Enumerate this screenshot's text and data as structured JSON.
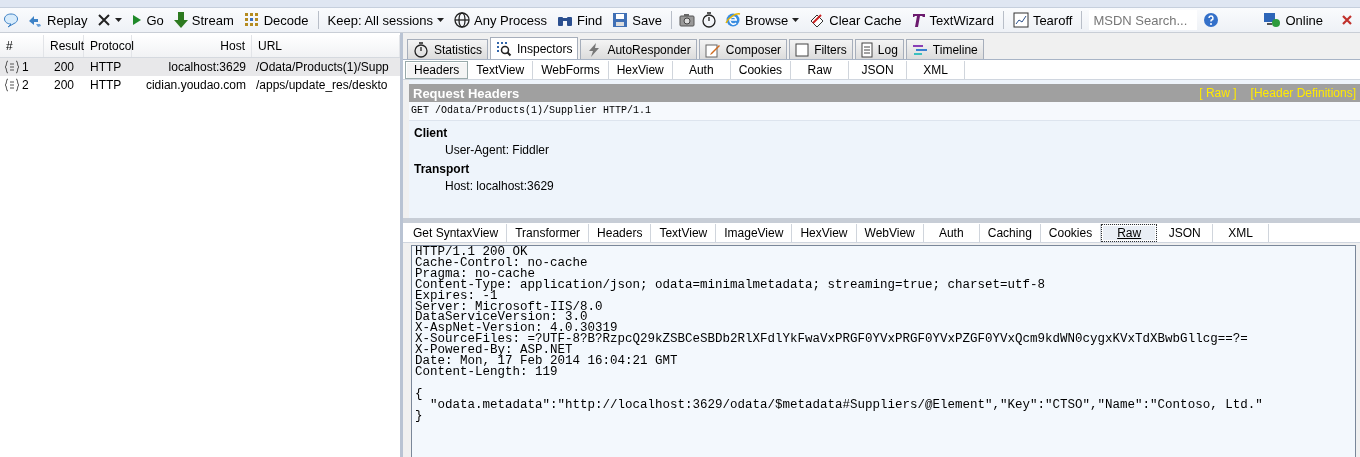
{
  "toolbar": {
    "items": [
      {
        "kind": "icon"
      },
      {
        "kind": "button",
        "label": "Replay"
      },
      {
        "kind": "dropdown"
      },
      {
        "kind": "button",
        "label": "Go"
      },
      {
        "kind": "button",
        "label": "Stream"
      },
      {
        "kind": "button",
        "label": "Decode"
      },
      {
        "kind": "separator"
      },
      {
        "kind": "dropdown",
        "label": "Keep: All sessions"
      },
      {
        "kind": "button",
        "label": "Any Process"
      },
      {
        "kind": "button",
        "label": "Find"
      },
      {
        "kind": "button",
        "label": "Save"
      },
      {
        "kind": "separator"
      },
      {
        "kind": "icon"
      },
      {
        "kind": "icon"
      },
      {
        "kind": "dropdown",
        "label": "Browse"
      },
      {
        "kind": "button",
        "label": "Clear Cache"
      },
      {
        "kind": "button",
        "label": "TextWizard"
      },
      {
        "kind": "separator"
      },
      {
        "kind": "button",
        "label": "Tearoff"
      },
      {
        "kind": "separator"
      },
      {
        "kind": "search",
        "placeholder": "MSDN Search..."
      },
      {
        "kind": "icon"
      }
    ],
    "status": "Online"
  },
  "sessions": {
    "columns": [
      "#",
      "Result",
      "Protocol",
      "Host",
      "URL"
    ],
    "rows": [
      {
        "id": "1",
        "result": "200",
        "protocol": "HTTP",
        "host": "localhost:3629",
        "url": "/Odata/Products(1)/Supp",
        "selected": true
      },
      {
        "id": "2",
        "result": "200",
        "protocol": "HTTP",
        "host": "cidian.youdao.com",
        "url": "/apps/update_res/deskto",
        "selected": false
      }
    ]
  },
  "tabs": [
    {
      "label": "Statistics",
      "selected": false
    },
    {
      "label": "Inspectors",
      "selected": true
    },
    {
      "label": "AutoResponder",
      "selected": false
    },
    {
      "label": "Composer",
      "selected": false
    },
    {
      "label": "Filters",
      "selected": false
    },
    {
      "label": "Log",
      "selected": false
    },
    {
      "label": "Timeline",
      "selected": false
    }
  ],
  "request_tabs": [
    {
      "label": "Headers",
      "selected": true
    },
    {
      "label": "TextView",
      "selected": false
    },
    {
      "label": "WebForms",
      "selected": false
    },
    {
      "label": "HexView",
      "selected": false
    },
    {
      "label": "Auth",
      "selected": false
    },
    {
      "label": "Cookies",
      "selected": false
    },
    {
      "label": "Raw",
      "selected": false
    },
    {
      "label": "JSON",
      "selected": false
    },
    {
      "label": "XML",
      "selected": false
    }
  ],
  "request_headers": {
    "title": "Request Headers",
    "links": [
      "[ Raw ]",
      "[Header Definitions]"
    ],
    "request_line": "GET /Odata/Products(1)/Supplier HTTP/1.1",
    "groups": [
      {
        "name": "Client",
        "headers": [
          "User-Agent: Fiddler"
        ]
      },
      {
        "name": "Transport",
        "headers": [
          "Host: localhost:3629"
        ]
      }
    ]
  },
  "response_tabs": [
    {
      "label": "Get SyntaxView",
      "selected": false
    },
    {
      "label": "Transformer",
      "selected": false
    },
    {
      "label": "Headers",
      "selected": false
    },
    {
      "label": "TextView",
      "selected": false
    },
    {
      "label": "ImageView",
      "selected": false
    },
    {
      "label": "HexView",
      "selected": false
    },
    {
      "label": "WebView",
      "selected": false
    },
    {
      "label": "Auth",
      "selected": false
    },
    {
      "label": "Caching",
      "selected": false
    },
    {
      "label": "Cookies",
      "selected": false
    },
    {
      "label": "Raw",
      "selected": true
    },
    {
      "label": "JSON",
      "selected": false
    },
    {
      "label": "XML",
      "selected": false
    }
  ],
  "response_body": {
    "headers": [
      "HTTP/1.1 200 OK",
      "Cache-Control: no-cache",
      "Pragma: no-cache",
      "Content-Type: application/json; odata=minimalmetadata; streaming=true; charset=utf-8",
      "Expires: -1",
      "Server: Microsoft-IIS/8.0",
      "DataServiceVersion: 3.0",
      "X-AspNet-Version: 4.0.30319",
      "X-SourceFiles: =?UTF-8?B?RzpcQ29kZSBCeSBDb2RlXFdlYkFwaVxPRGF0YVxPRGF0YVxPZGF0YVxQcm9kdWN0cygxKVxTdXBwbGllcg==?=",
      "X-Powered-By: ASP.NET",
      "Date: Mon, 17 Feb 2014 16:04:21 GMT",
      "Content-Length: 119"
    ],
    "content": [
      "{",
      "  \"odata.metadata\":\"http://localhost:3629/odata/$metadata#Suppliers/@Element\",\"Key\":\"CTSO\",\"Name\":\"Contoso, Ltd.\"",
      "}"
    ]
  }
}
